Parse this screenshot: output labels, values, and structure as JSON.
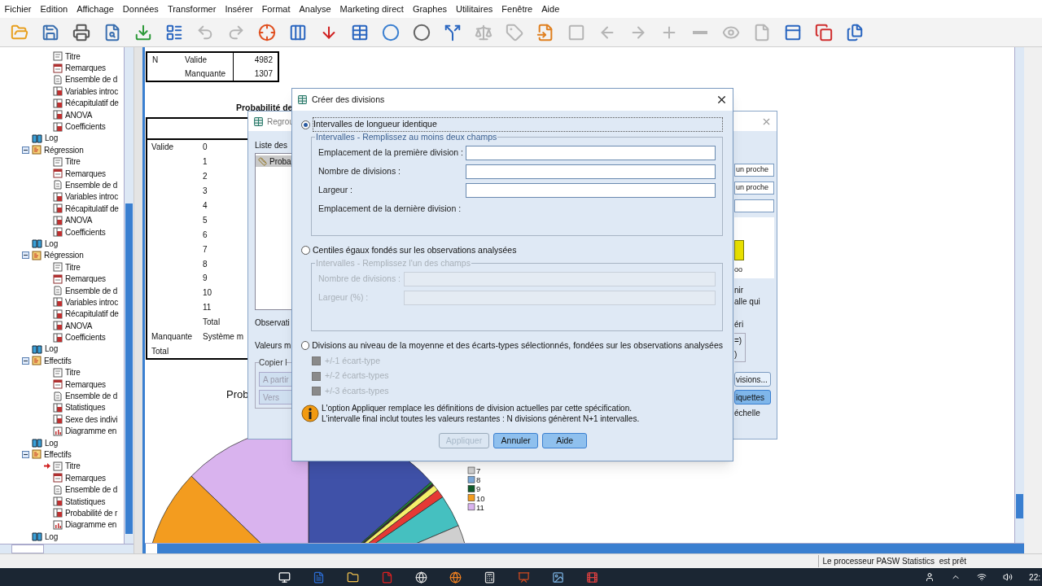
{
  "menu": [
    "Fichier",
    "Edition",
    "Affichage",
    "Données",
    "Transformer",
    "Insérer",
    "Format",
    "Analyse",
    "Marketing direct",
    "Graphes",
    "Utilitaires",
    "Fenêtre",
    "Aide"
  ],
  "toolbar": [
    {
      "disabled": false
    },
    {
      "disabled": false
    },
    {
      "disabled": false
    },
    {
      "disabled": false
    },
    {
      "disabled": false
    },
    {
      "disabled": false
    },
    {
      "disabled": true
    },
    {
      "disabled": true
    },
    {
      "disabled": false
    },
    {
      "disabled": false
    },
    {
      "disabled": false
    },
    {
      "disabled": false
    },
    {
      "disabled": false
    },
    {
      "disabled": false
    },
    {
      "disabled": false
    },
    {
      "disabled": true
    },
    {
      "disabled": true
    },
    {
      "disabled": false
    },
    {
      "disabled": true
    },
    {
      "disabled": true
    },
    {
      "disabled": true
    },
    {
      "disabled": true
    },
    {
      "disabled": true
    },
    {
      "disabled": true
    },
    {
      "disabled": true
    },
    {
      "disabled": false
    },
    {
      "disabled": false
    },
    {
      "disabled": false
    }
  ],
  "tree": {
    "items": [
      {
        "kind": "procedure",
        "expanded": true,
        "children": [
          {
            "kind": "title",
            "label": "Titre",
            "current": false
          },
          {
            "kind": "notes",
            "label": "Remarques",
            "current": false
          },
          {
            "kind": "dataset",
            "label": "Ensemble de d",
            "current": false
          },
          {
            "kind": "table",
            "label": "Variables introc",
            "current": false
          },
          {
            "kind": "table",
            "label": "Récapitulatif de",
            "current": false
          },
          {
            "kind": "table",
            "label": "ANOVA",
            "current": false
          },
          {
            "kind": "table",
            "label": "Coefficients",
            "current": false
          }
        ]
      },
      {
        "kind": "log",
        "label": "Log",
        "current": false
      },
      {
        "kind": "procedure",
        "label": "Régression",
        "expanded": true,
        "children": [
          {
            "kind": "title",
            "label": "Titre",
            "current": false
          },
          {
            "kind": "notes",
            "label": "Remarques",
            "current": false
          },
          {
            "kind": "dataset",
            "label": "Ensemble de d",
            "current": false
          },
          {
            "kind": "table",
            "label": "Variables introc",
            "current": false
          },
          {
            "kind": "table",
            "label": "Récapitulatif de",
            "current": false
          },
          {
            "kind": "table",
            "label": "ANOVA",
            "current": false
          },
          {
            "kind": "table",
            "label": "Coefficients",
            "current": false
          }
        ]
      },
      {
        "kind": "log",
        "label": "Log",
        "current": false
      },
      {
        "kind": "procedure",
        "label": "Régression",
        "expanded": true,
        "children": [
          {
            "kind": "title",
            "label": "Titre",
            "current": false
          },
          {
            "kind": "notes",
            "label": "Remarques",
            "current": false
          },
          {
            "kind": "dataset",
            "label": "Ensemble de d",
            "current": false
          },
          {
            "kind": "table",
            "label": "Variables introc",
            "current": false
          },
          {
            "kind": "table",
            "label": "Récapitulatif de",
            "current": false
          },
          {
            "kind": "table",
            "label": "ANOVA",
            "current": false
          },
          {
            "kind": "table",
            "label": "Coefficients",
            "current": false
          }
        ]
      },
      {
        "kind": "log",
        "label": "Log",
        "current": false
      },
      {
        "kind": "procedure",
        "label": "Effectifs",
        "expanded": true,
        "children": [
          {
            "kind": "title",
            "label": "Titre",
            "current": false
          },
          {
            "kind": "notes",
            "label": "Remarques",
            "current": false
          },
          {
            "kind": "dataset",
            "label": "Ensemble de d",
            "current": false
          },
          {
            "kind": "table",
            "label": "Statistiques",
            "current": false
          },
          {
            "kind": "table",
            "label": "Sexe des indivi",
            "current": false
          },
          {
            "kind": "chart",
            "label": "Diagramme en",
            "current": false
          }
        ]
      },
      {
        "kind": "log",
        "label": "Log",
        "current": false
      },
      {
        "kind": "procedure",
        "label": "Effectifs",
        "expanded": true,
        "children": [
          {
            "kind": "title",
            "label": "Titre",
            "current": true
          },
          {
            "kind": "notes",
            "label": "Remarques",
            "current": false
          },
          {
            "kind": "dataset",
            "label": "Ensemble de d",
            "current": false
          },
          {
            "kind": "table",
            "label": "Statistiques",
            "current": false
          },
          {
            "kind": "table",
            "label": "Probabilité de r",
            "current": false
          },
          {
            "kind": "chart",
            "label": "Diagramme en",
            "current": false
          }
        ]
      },
      {
        "kind": "log",
        "label": "Log",
        "current": false
      }
    ]
  },
  "output": {
    "stats_table": [
      {
        "label": "N",
        "category": "Valide",
        "value": "4982"
      },
      {
        "category": "Manquante",
        "value": "1307"
      }
    ],
    "frequency_title": "Probabilité de",
    "frequency_rows": [
      {
        "group": "Valide",
        "value": "0"
      },
      {
        "value": "1"
      },
      {
        "value": "2"
      },
      {
        "value": "3"
      },
      {
        "value": "4"
      },
      {
        "value": "5"
      },
      {
        "value": "6"
      },
      {
        "value": "7"
      },
      {
        "value": "8"
      },
      {
        "value": "9"
      },
      {
        "value": "10"
      },
      {
        "value": "11"
      },
      {
        "value": "Total"
      },
      {
        "group": "Manquante",
        "value": "Système m"
      },
      {
        "group": "Total"
      }
    ],
    "chart_title": "Prob",
    "legend": [
      {
        "label": "7",
        "color": "#d0d0d0"
      },
      {
        "label": "8",
        "color": "#7aa7d8"
      },
      {
        "label": "9",
        "color": "#0e5a2a"
      },
      {
        "label": "10",
        "color": "#f39c1f"
      },
      {
        "label": "11",
        "color": "#d9b3ee"
      }
    ]
  },
  "background_dialog": {
    "title": "Regrou",
    "list_label": "Liste des",
    "list_items": [
      {
        "label": "Proba",
        "selected": true
      }
    ],
    "labels": [
      "Observati",
      "Valeurs m"
    ],
    "group_title": "Copier l",
    "group_buttons": [
      "A partir",
      "Vers"
    ],
    "fields": [
      "un proche",
      "un proche"
    ],
    "preview_text": "oo",
    "texts": [
      "nir",
      "alle qui",
      "éri"
    ],
    "box_texts": [
      "=)",
      ")"
    ],
    "buttons": [
      {
        "label": "visions...",
        "default": false
      },
      {
        "label": "iquettes",
        "default": true
      }
    ],
    "link": "échelle"
  },
  "dialog": {
    "title": "Créer des divisions",
    "options": [
      {
        "kind": "fields",
        "label": "Intervalles de longueur identique",
        "selected": true,
        "group_title": "Intervalles - Remplissez au moins deux champs",
        "fields": [
          "Emplacement de la première division :",
          "Nombre de divisions :",
          "Largeur :"
        ],
        "result_label": "Emplacement de la dernière division :"
      },
      {
        "kind": "fields",
        "label": "Centiles égaux fondés sur les observations analysées",
        "selected": false,
        "group_title": "Intervalles - Remplissez l'un des champs",
        "fields": [
          "Nombre de divisions :",
          "Largeur (%) :"
        ]
      },
      {
        "kind": "checks",
        "label": "Divisions au niveau de la moyenne et des écarts-types sélectionnés, fondées sur les observations analysées",
        "selected": false,
        "checks": [
          {
            "label": "+/-1 écart-type",
            "checked": false
          },
          {
            "label": "+/-2 écarts-types",
            "checked": false
          },
          {
            "label": "+/-3 écarts-types",
            "checked": false
          }
        ]
      }
    ],
    "note": [
      "L'option Appliquer remplace les définitions de division actuelles par cette spécification.",
      "L'intervalle final inclut toutes les valeurs restantes : N divisions génèrent N+1 intervalles."
    ],
    "buttons": [
      {
        "label": "Appliquer",
        "disabled": true
      },
      {
        "label": "Annuler",
        "disabled": false
      },
      {
        "label": "Aide",
        "disabled": false
      }
    ]
  },
  "status_bar": "Le processeur PASW Statistics  est prêt",
  "taskbar": {
    "clock": "22:"
  }
}
